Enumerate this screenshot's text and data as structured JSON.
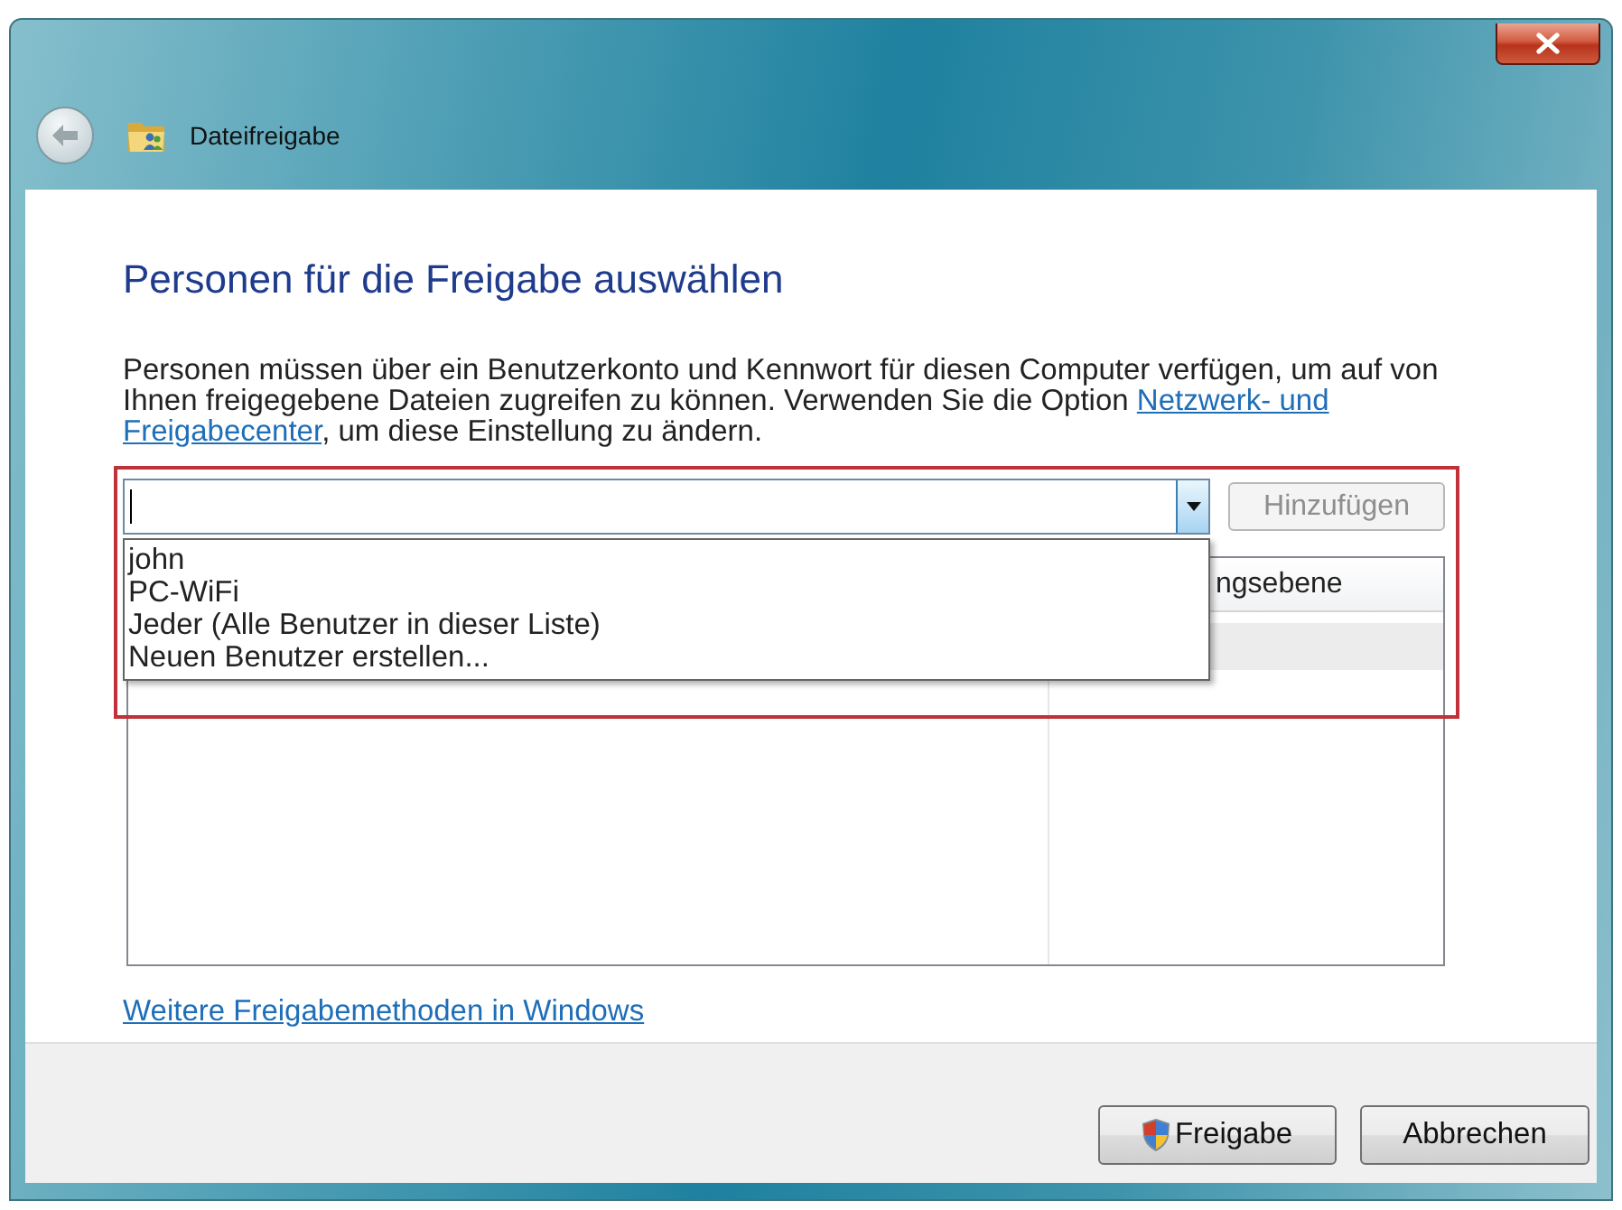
{
  "window": {
    "title": "Dateifreigabe",
    "back_button": {
      "disabled": true
    }
  },
  "heading": "Personen für die Freigabe auswählen",
  "description": {
    "text": "Personen müssen über ein Benutzerkonto und Kennwort für diesen Computer verfügen, um auf von Ihnen freigegebene Dateien zugreifen zu können. Verwenden Sie die Option",
    "link_lines": [
      "Netzwerk- und",
      "Freigabecenter"
    ],
    "text_after": ", um diese Einstellung zu ändern."
  },
  "user_combo": {
    "expanded": true,
    "options": [
      {
        "label": "john",
        "selected": false
      },
      {
        "label": "PC-WiFi",
        "selected": false
      },
      {
        "label": "Jeder (Alle Benutzer in dieser Liste)",
        "selected": false
      },
      {
        "label": "Neuen Benutzer erstellen...",
        "selected": false
      }
    ]
  },
  "add_button": {
    "label": "Hinzufügen",
    "disabled": true
  },
  "table": {
    "column_2": "ngsebene"
  },
  "more_link": "Weitere Freigabemethoden in Windows",
  "buttons": [
    {
      "label": "Freigabe",
      "kind": "elevated"
    },
    {
      "label": "Abbrechen",
      "kind": "plain"
    }
  ]
}
